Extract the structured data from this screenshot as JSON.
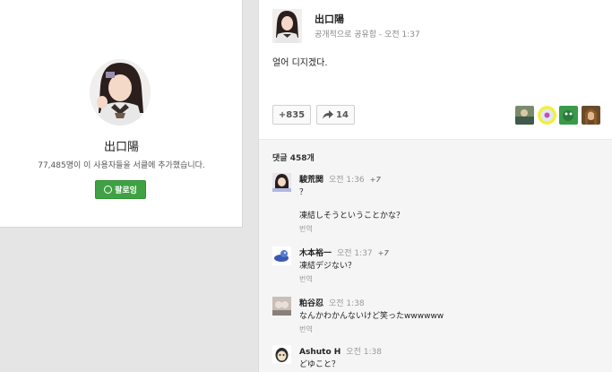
{
  "profile": {
    "name": "出口陽",
    "followers": "77,485명이 이 사용자들을 서클에 추가했습니다.",
    "follow_label": "팔로잉"
  },
  "post": {
    "author": "出口陽",
    "visibility": "공개적으로 공유함",
    "time": "오전 1:37",
    "text": "얼어 디지겠다.",
    "plus_count": "+835",
    "share_count": "14"
  },
  "comments_header": "댓글 458개",
  "comments": [
    {
      "author": "駿荒関",
      "time": "오전 1:36",
      "plus": "+7",
      "lines": [
        "？",
        "凍結しそうということかな？"
      ],
      "translate": "번역"
    },
    {
      "author": "木本裕一",
      "time": "오전 1:37",
      "plus": "+7",
      "lines": [
        "凍結デジない？"
      ],
      "translate": "번역"
    },
    {
      "author": "粕谷忍",
      "time": "오전 1:38",
      "lines": [
        "なんかわかんないけど笑ったwwwwww"
      ],
      "translate": "번역"
    },
    {
      "author": "Ashuto H",
      "time": "오전 1:38",
      "lines": [
        "どゆこと？"
      ]
    }
  ],
  "colors": {
    "follow_green": "#3fa144",
    "accent_text": "#222222",
    "meta_gray": "#888888"
  }
}
